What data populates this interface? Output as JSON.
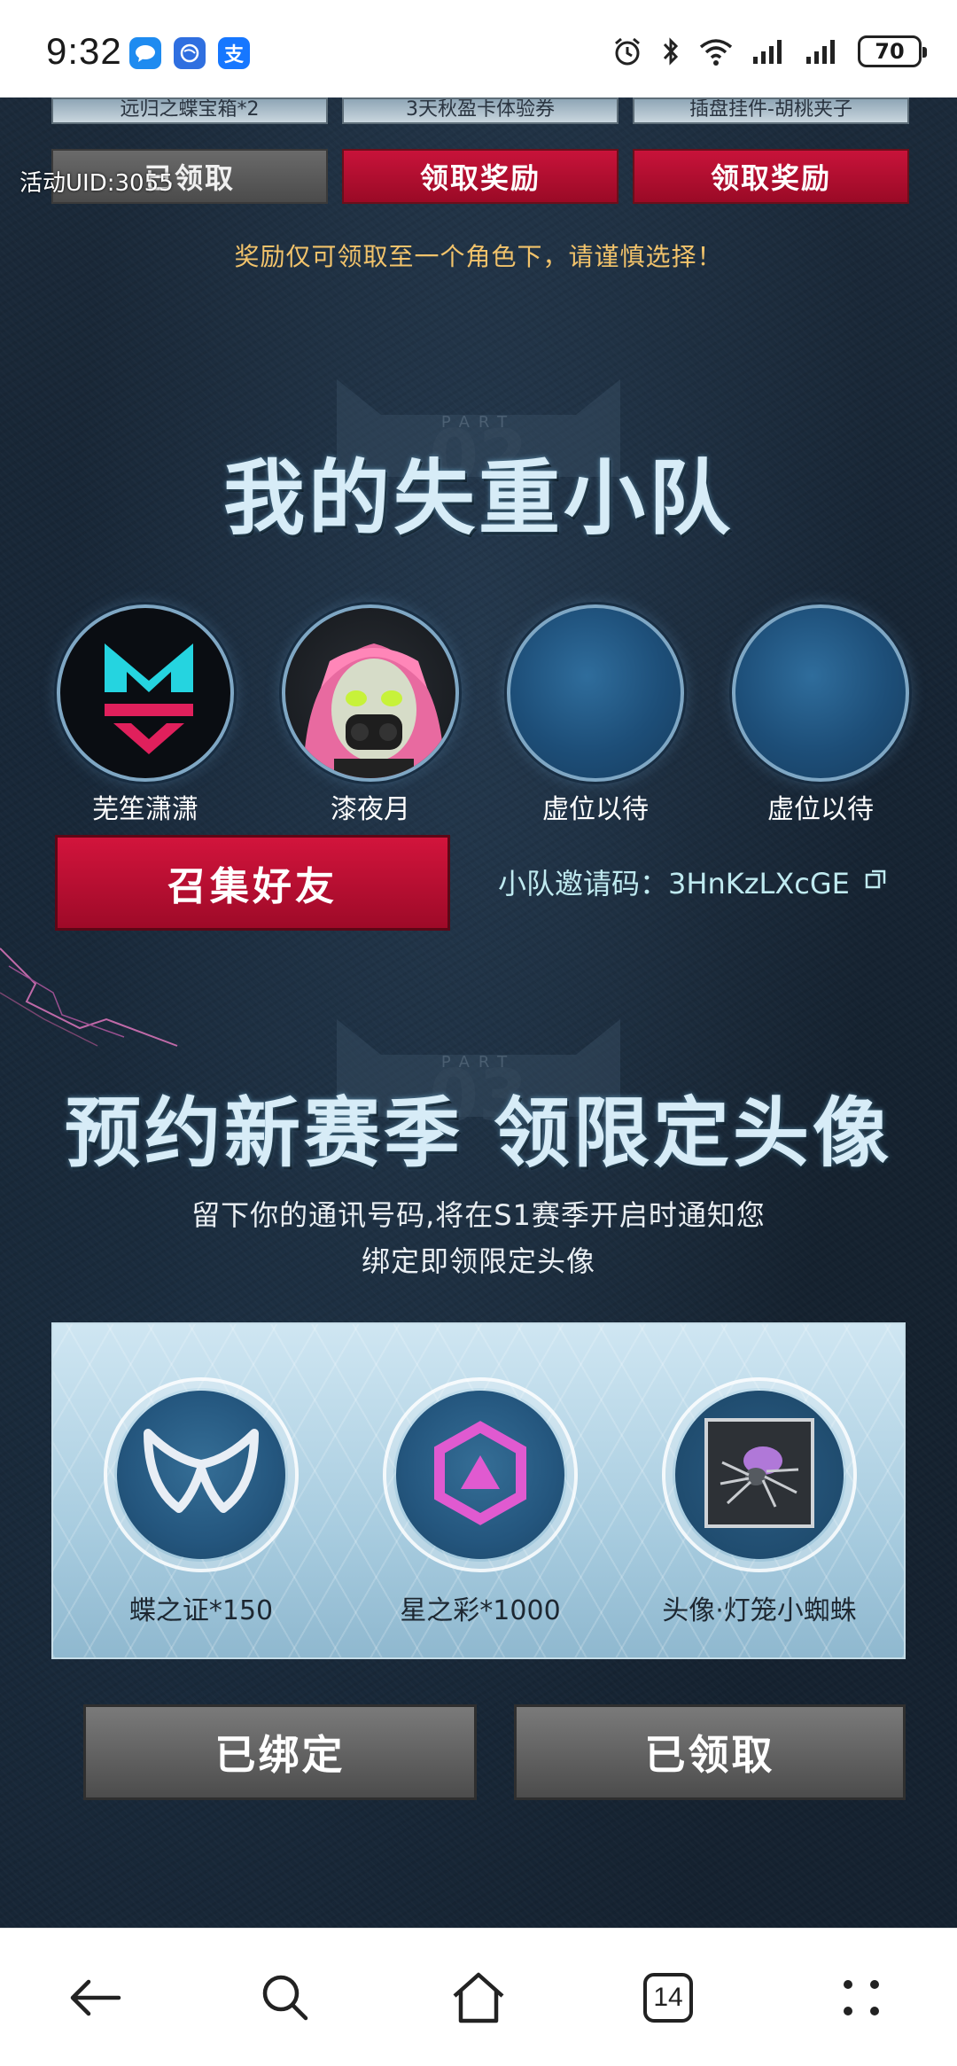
{
  "status_bar": {
    "time": "9:32",
    "battery": "70",
    "apps": [
      "chat-app-icon",
      "browser-app-icon",
      "alipay-icon"
    ],
    "alipay_glyph": "支"
  },
  "prev_section": {
    "cards": [
      "远归之蝶宝箱*2",
      "3天秋盈卡体验券",
      "插盘挂件-胡桃夹子"
    ],
    "buttons": [
      {
        "label": "已领取",
        "state": "claimed"
      },
      {
        "label": "领取奖励",
        "state": "active"
      },
      {
        "label": "领取奖励",
        "state": "active"
      }
    ],
    "uid_label": "活动UID:3055",
    "note": "奖励仅可领取至一个角色下，请谨慎选择！"
  },
  "squad_section": {
    "part_label": "PART",
    "part_number": "02",
    "title": "我的失重小队",
    "members": [
      {
        "name": "芜笙潇潇",
        "avatar": "m-logo"
      },
      {
        "name": "漆夜月",
        "avatar": "girl"
      },
      {
        "name": "虚位以待",
        "avatar": "empty"
      },
      {
        "name": "虚位以待",
        "avatar": "empty"
      }
    ],
    "recruit_button": "召集好友",
    "invite_label": "小队邀请码：",
    "invite_code": "3HnKzLXcGE"
  },
  "season_section": {
    "part_label": "PART",
    "part_number": "03",
    "title": "预约新赛季 领限定头像",
    "subtitle_line1": "留下你的通讯号码,将在S1赛季开启时通知您",
    "subtitle_line2": "绑定即领限定头像",
    "rewards": [
      {
        "label": "蝶之证*150",
        "icon": "butterfly-badge-icon"
      },
      {
        "label": "星之彩*1000",
        "icon": "hexagon-crystal-icon"
      },
      {
        "label": "头像·灯笼小蜘蛛",
        "icon": "spider-avatar-icon"
      }
    ],
    "bind_button": "已绑定",
    "claim_button": "已领取"
  },
  "nav_bar": {
    "tab_count": "14"
  },
  "colors": {
    "accent_red": "#c8133a",
    "note_gold": "#f2c36b",
    "title_ice": "#d7ecf7"
  }
}
